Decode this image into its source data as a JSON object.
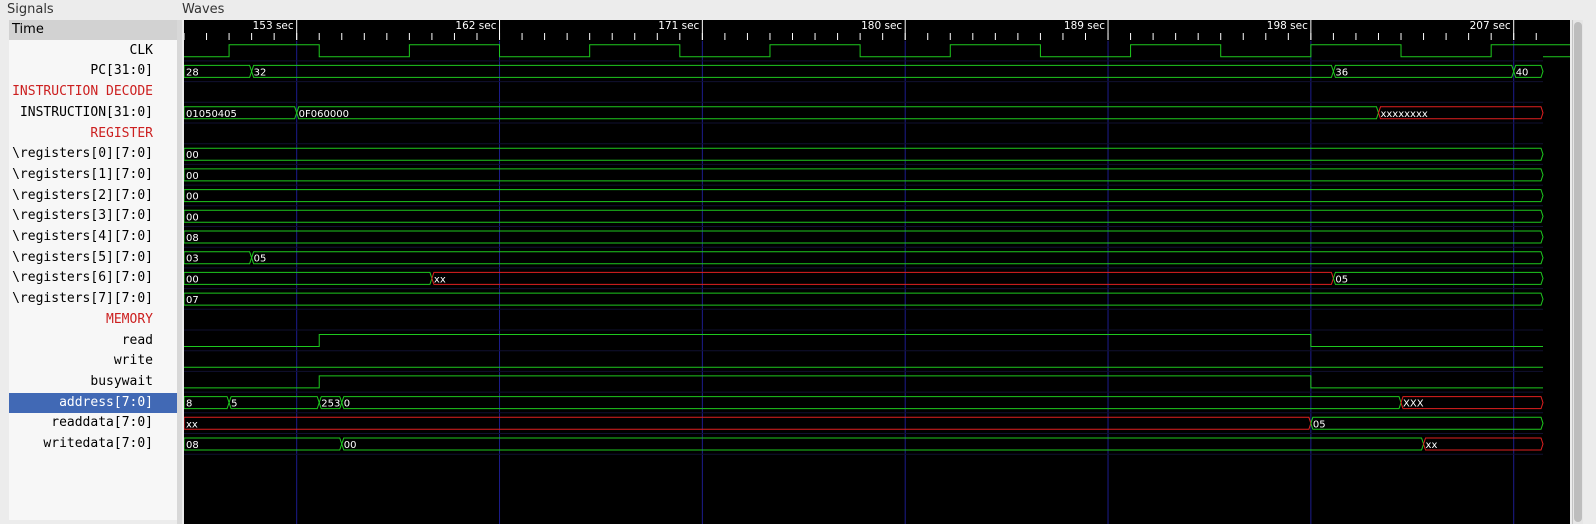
{
  "panels": {
    "signals_title": "Signals",
    "waves_title": "Waves"
  },
  "time_header": "Time",
  "timeline": {
    "unit": "sec",
    "visible_start": 148,
    "visible_end": 208.3,
    "labels": [
      153,
      162,
      171,
      180,
      189,
      198,
      207
    ],
    "label_texts": [
      "153 sec",
      "162 sec",
      "171 sec",
      "180 sec",
      "189 sec",
      "198 sec",
      "207 sec"
    ]
  },
  "signals": [
    {
      "name": "CLK",
      "kind": "clock",
      "period": 8,
      "high_first": 150,
      "high_len": 4,
      "cycles": 9
    },
    {
      "name": "PC[31:0]",
      "kind": "bus",
      "segments": [
        {
          "t": 148,
          "v": "28",
          "color": "#1ec81e"
        },
        {
          "t": 151,
          "v": "32",
          "color": "#1ec81e"
        },
        {
          "t": 199,
          "v": "36",
          "color": "#1ec81e"
        },
        {
          "t": 207,
          "v": "40",
          "color": "#1ec81e"
        }
      ]
    },
    {
      "name": "INSTRUCTION DECODE",
      "kind": "section"
    },
    {
      "name": "INSTRUCTION[31:0]",
      "kind": "bus",
      "segments": [
        {
          "t": 148,
          "v": "01050405",
          "color": "#1ec81e"
        },
        {
          "t": 153,
          "v": "0F060000",
          "color": "#1ec81e"
        },
        {
          "t": 201,
          "v": "xxxxxxxx",
          "color": "#e02020"
        }
      ]
    },
    {
      "name": "REGISTER",
      "kind": "section"
    },
    {
      "name": "\\registers[0][7:0]",
      "kind": "bus",
      "segments": [
        {
          "t": 148,
          "v": "00",
          "color": "#1ec81e"
        }
      ]
    },
    {
      "name": "\\registers[1][7:0]",
      "kind": "bus",
      "segments": [
        {
          "t": 148,
          "v": "00",
          "color": "#1ec81e"
        }
      ]
    },
    {
      "name": "\\registers[2][7:0]",
      "kind": "bus",
      "segments": [
        {
          "t": 148,
          "v": "00",
          "color": "#1ec81e"
        }
      ]
    },
    {
      "name": "\\registers[3][7:0]",
      "kind": "bus",
      "segments": [
        {
          "t": 148,
          "v": "00",
          "color": "#1ec81e"
        }
      ]
    },
    {
      "name": "\\registers[4][7:0]",
      "kind": "bus",
      "segments": [
        {
          "t": 148,
          "v": "08",
          "color": "#1ec81e"
        }
      ]
    },
    {
      "name": "\\registers[5][7:0]",
      "kind": "bus",
      "segments": [
        {
          "t": 148,
          "v": "03",
          "color": "#1ec81e"
        },
        {
          "t": 151,
          "v": "05",
          "color": "#1ec81e"
        }
      ]
    },
    {
      "name": "\\registers[6][7:0]",
      "kind": "bus",
      "segments": [
        {
          "t": 148,
          "v": "00",
          "color": "#1ec81e"
        },
        {
          "t": 159,
          "v": "xx",
          "color": "#e02020"
        },
        {
          "t": 199,
          "v": "05",
          "color": "#1ec81e"
        }
      ]
    },
    {
      "name": "\\registers[7][7:0]",
      "kind": "bus",
      "segments": [
        {
          "t": 148,
          "v": "07",
          "color": "#1ec81e"
        }
      ]
    },
    {
      "name": "MEMORY",
      "kind": "section"
    },
    {
      "name": "read",
      "kind": "bit",
      "edges": [
        {
          "t": 148,
          "v": 0
        },
        {
          "t": 154,
          "v": 1
        },
        {
          "t": 198,
          "v": 0
        }
      ]
    },
    {
      "name": "write",
      "kind": "bit",
      "edges": [
        {
          "t": 148,
          "v": 0
        }
      ]
    },
    {
      "name": "busywait",
      "kind": "bit",
      "edges": [
        {
          "t": 148,
          "v": 0
        },
        {
          "t": 154,
          "v": 1
        },
        {
          "t": 198,
          "v": 0
        }
      ]
    },
    {
      "name": "address[7:0]",
      "kind": "bus",
      "selected": true,
      "segments": [
        {
          "t": 148,
          "v": "8",
          "color": "#1ec81e"
        },
        {
          "t": 150,
          "v": "5",
          "color": "#1ec81e"
        },
        {
          "t": 154,
          "v": "253",
          "color": "#1ec81e"
        },
        {
          "t": 155,
          "v": "0",
          "color": "#1ec81e"
        },
        {
          "t": 202,
          "v": "XXX",
          "color": "#e02020"
        }
      ]
    },
    {
      "name": "readdata[7:0]",
      "kind": "bus",
      "segments": [
        {
          "t": 148,
          "v": "xx",
          "color": "#e02020"
        },
        {
          "t": 198,
          "v": "05",
          "color": "#1ec81e"
        }
      ]
    },
    {
      "name": "writedata[7:0]",
      "kind": "bus",
      "segments": [
        {
          "t": 148,
          "v": "08",
          "color": "#1ec81e"
        },
        {
          "t": 155,
          "v": "00",
          "color": "#1ec81e"
        },
        {
          "t": 203,
          "v": "xx",
          "color": "#e02020"
        }
      ]
    }
  ],
  "colors": {
    "wave": "#1ec81e",
    "undefined": "#e02020",
    "grid": "#1c1c8c",
    "ruler": "#ffffff",
    "section": "#cc1f1f",
    "selection": "#4169b5"
  }
}
